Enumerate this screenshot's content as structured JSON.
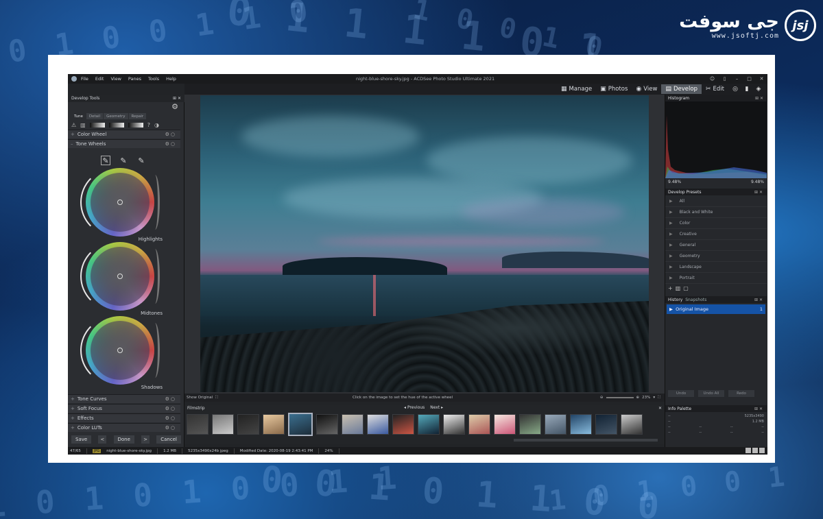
{
  "watermark": {
    "brand": "جی سوفت",
    "url": "www.jsoftj.com",
    "mark": "jsj"
  },
  "window": {
    "title": "night-blue-shore-sky.jpg - ACDSee Photo Studio Ultimate 2021"
  },
  "menu": [
    "File",
    "Edit",
    "View",
    "Panes",
    "Tools",
    "Help"
  ],
  "modes": [
    {
      "label": "Manage",
      "icon": "grid-icon"
    },
    {
      "label": "Photos",
      "icon": "photos-icon"
    },
    {
      "label": "View",
      "icon": "eye-icon"
    },
    {
      "label": "Develop",
      "icon": "develop-icon",
      "active": true
    },
    {
      "label": "Edit",
      "icon": "edit-icon"
    }
  ],
  "left_panel": {
    "title": "Develop Tools",
    "tabs": [
      "Tune",
      "Detail",
      "Geometry",
      "Repair"
    ],
    "sections_top": [
      "Color Wheel",
      "Tone Wheels"
    ],
    "wheels": [
      "Highlights",
      "Midtones",
      "Shadows"
    ],
    "sections_bottom": [
      "Tone Curves",
      "Soft Focus",
      "Effects",
      "Color LUTs"
    ],
    "buttons": {
      "save": "Save",
      "done": "Done",
      "cancel": "Cancel",
      "prev": "<",
      "next": ">"
    }
  },
  "image_status": {
    "show_original": "Show Original",
    "hint": "Click on the image to set the hue of the active wheel",
    "zoom": "23%"
  },
  "filmstrip": {
    "title": "Filmstrip",
    "previous": "Previous",
    "next": "Next",
    "thumb_count": 18
  },
  "histogram": {
    "title": "Histogram",
    "left_value": "9.48%",
    "right_value": "9.48%"
  },
  "presets": {
    "title": "Develop Presets",
    "items": [
      "All",
      "Black and White",
      "Color",
      "Creative",
      "General",
      "Geometry",
      "Landscape",
      "Portrait"
    ]
  },
  "history": {
    "tabs": [
      "History",
      "Snapshots"
    ],
    "item": "Original Image",
    "item_num": "1",
    "buttons": [
      "Undo",
      "Undo All",
      "Redo"
    ]
  },
  "info": {
    "title": "Info Palette",
    "dims": "5235x3490",
    "size": "1.2 MB"
  },
  "statusbar": {
    "count": "47/65",
    "type": "JPG",
    "filename": "night-blue-shore-sky.jpg",
    "size": "1.2 MB",
    "dims": "5235x3490x24b jpeg",
    "modified": "Modified Date: 2020-08-19 2:43:41 PM",
    "zoom": "24%"
  },
  "colors": {
    "accent": "#1553a6",
    "active_mode": "#555a61",
    "panel": "#2b2d31"
  }
}
